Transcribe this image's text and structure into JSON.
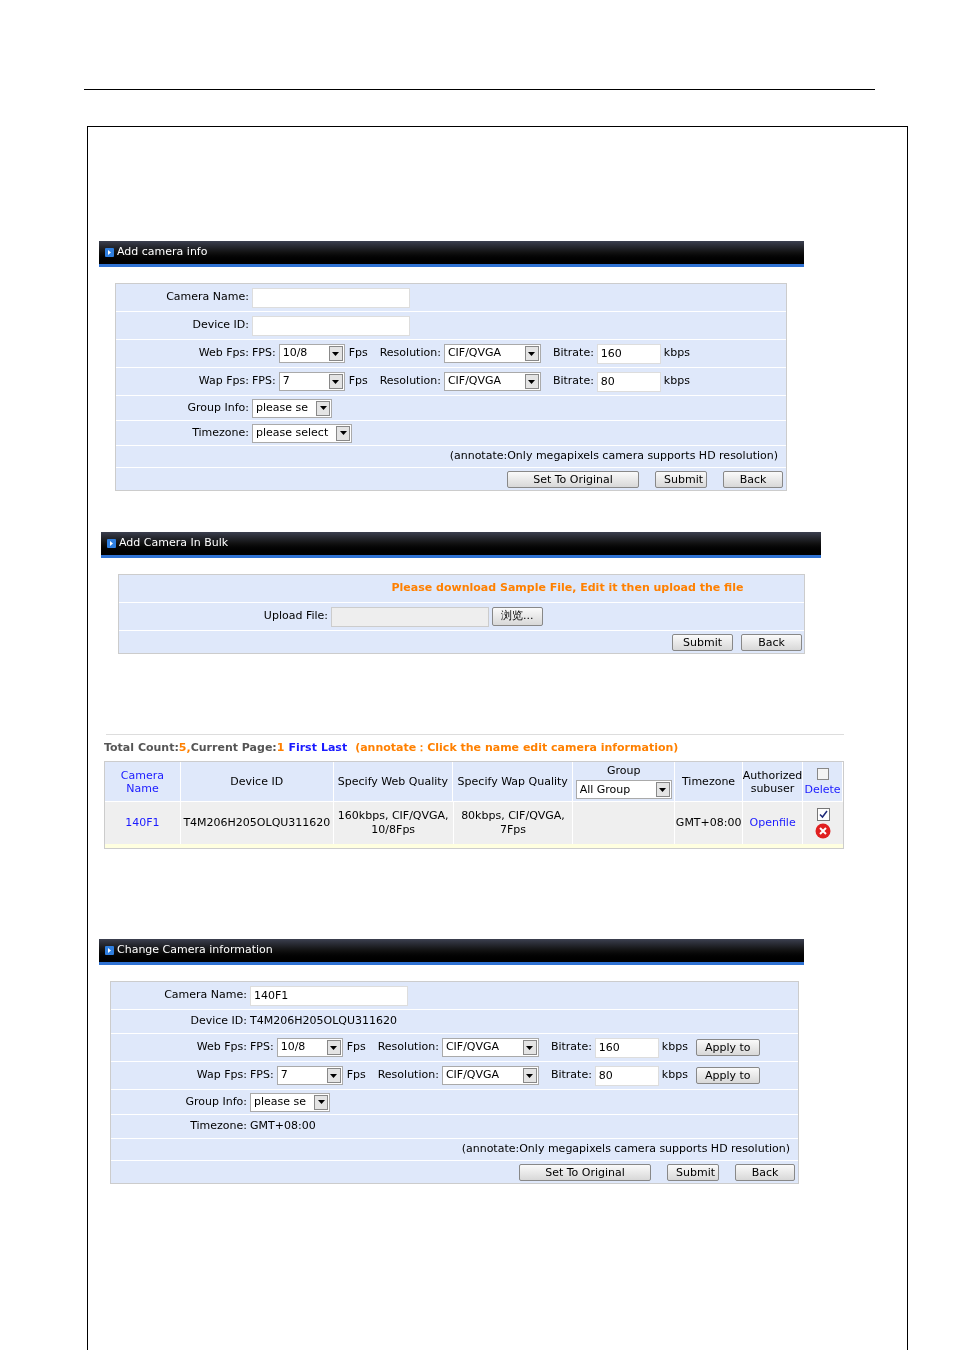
{
  "add_camera": {
    "title": "Add camera info",
    "rows": [
      {
        "kind": "field",
        "label": "Camera Name:"
      },
      {
        "kind": "field",
        "label": "Device ID:"
      },
      {
        "kind": "quality",
        "label": "Web Fps:",
        "fps_label": "FPS:",
        "fps": "10/8",
        "fps_unit": "Fps",
        "res_label": "Resolution:",
        "resolution": "CIF/QVGA",
        "bitrate_label": "Bitrate:",
        "bitrate": "160",
        "bitrate_unit": "kbps"
      },
      {
        "kind": "quality",
        "label": "Wap Fps:",
        "fps_label": "FPS:",
        "fps": "7",
        "fps_unit": "Fps",
        "res_label": "Resolution:",
        "resolution": "CIF/QVGA",
        "bitrate_label": "Bitrate:",
        "bitrate": "80",
        "bitrate_unit": "kbps"
      },
      {
        "kind": "select",
        "label": "Group Info:",
        "value": "please se"
      },
      {
        "kind": "select",
        "label": "Timezone:",
        "value": "please select"
      },
      {
        "kind": "note",
        "text": "(annotate:Only megapixels camera supports HD resolution)"
      },
      {
        "kind": "buttons",
        "buttons": [
          "Set To Original",
          "Submit",
          "Back"
        ]
      }
    ]
  },
  "bulk": {
    "title": "Add Camera In Bulk",
    "message": "Please download **Sample File**, Edit it then upload the file",
    "upload_label": "Upload File:",
    "browse": "浏览...",
    "buttons": [
      "Submit",
      "Back"
    ]
  },
  "list": {
    "total_label": "Total Count:",
    "total": "5,",
    "page_label": "Current Page:",
    "page": "1",
    "first": "First",
    "last": "Last",
    "annotate": "(annotate：Click the name edit camera information)",
    "columns": [
      {
        "label": "Camera Name",
        "kind": "link"
      },
      {
        "label": "Device ID",
        "kind": "text"
      },
      {
        "label": "Specify Web Quality",
        "kind": "text"
      },
      {
        "label": "Specify Wap Quality",
        "kind": "text"
      },
      {
        "label": "Group",
        "kind": "group",
        "value": "All Group"
      },
      {
        "label": "Timezone",
        "kind": "text"
      },
      {
        "label": "Authorized subuser",
        "kind": "text"
      },
      {
        "label": "Delete",
        "kind": "delete",
        "checked": false
      }
    ],
    "rows": [
      {
        "name": "140F1",
        "device_id": "T4M206H205OLQU311620",
        "web_quality": "160kbps, CIF/QVGA, 10/8Fps",
        "wap_quality": "80kbps, CIF/QVGA, 7Fps",
        "timezone": "GMT+08:00",
        "subuser": "Openfile",
        "checked": true
      }
    ]
  },
  "change_camera": {
    "title": "Change Camera information",
    "rows": [
      {
        "kind": "field",
        "label": "Camera Name:",
        "value": "140F1"
      },
      {
        "kind": "text",
        "label": "Device ID:",
        "value": "T4M206H205OLQU311620"
      },
      {
        "kind": "quality",
        "label": "Web Fps:",
        "fps_label": "FPS:",
        "fps": "10/8",
        "fps_unit": "Fps",
        "res_label": "Resolution:",
        "resolution": "CIF/QVGA",
        "bitrate_label": "Bitrate:",
        "bitrate": "160",
        "bitrate_unit": "kbps",
        "apply": "Apply to"
      },
      {
        "kind": "quality",
        "label": "Wap Fps:",
        "fps_label": "FPS:",
        "fps": "7",
        "fps_unit": "Fps",
        "res_label": "Resolution:",
        "resolution": "CIF/QVGA",
        "bitrate_label": "Bitrate:",
        "bitrate": "80",
        "bitrate_unit": "kbps",
        "apply": "Apply to"
      },
      {
        "kind": "select",
        "label": "Group Info:",
        "value": "please se"
      },
      {
        "kind": "text",
        "label": "Timezone:",
        "value": "GMT+08:00"
      },
      {
        "kind": "note",
        "text": "(annotate:Only megapixels camera supports HD resolution)"
      },
      {
        "kind": "buttons",
        "buttons": [
          "Set To Original",
          "Submit",
          "Back"
        ]
      }
    ]
  }
}
